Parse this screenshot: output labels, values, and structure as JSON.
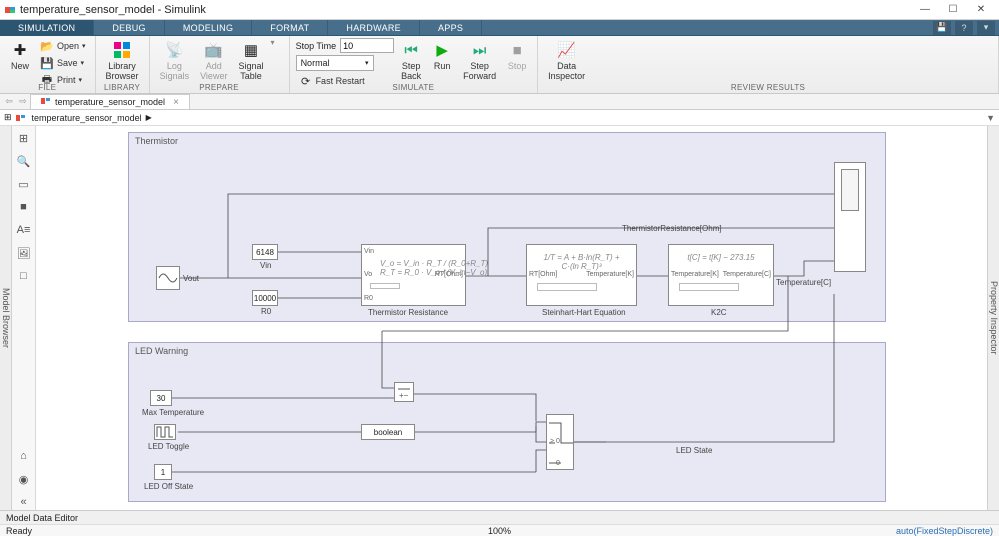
{
  "window": {
    "title": "temperature_sensor_model - Simulink"
  },
  "tabs": [
    "SIMULATION",
    "DEBUG",
    "MODELING",
    "FORMAT",
    "HARDWARE",
    "APPS"
  ],
  "ribbon": {
    "file_group": {
      "new": "New",
      "open": "Open",
      "save": "Save",
      "print": "Print",
      "label": "FILE"
    },
    "library_group": {
      "browser": "Library\nBrowser",
      "label": "LIBRARY"
    },
    "prepare_group": {
      "log": "Log\nSignals",
      "viewer": "Add\nViewer",
      "table": "Signal\nTable",
      "label": "PREPARE"
    },
    "sim_group": {
      "stoptime": "Stop Time",
      "stoptime_val": "10",
      "mode": "Normal",
      "fastrestart": "Fast Restart",
      "stepback": "Step\nBack",
      "run": "Run",
      "stepfwd": "Step\nForward",
      "stop": "Stop",
      "label": "SIMULATE"
    },
    "review_group": {
      "inspector": "Data\nInspector",
      "label": "REVIEW RESULTS"
    }
  },
  "file_tab": "temperature_sensor_model",
  "crumb": "temperature_sensor_model",
  "left_sidebar": "Model Browser",
  "right_sidebar": "Property Inspector",
  "canvas": {
    "area1": {
      "label": "Thermistor"
    },
    "area2": {
      "label": "LED Warning"
    },
    "vin": {
      "label": "Vin",
      "value": "6148"
    },
    "r0": {
      "label": "R0",
      "value": "10000"
    },
    "vout": {
      "label": "Vout"
    },
    "thermres": {
      "label": "Thermistor Resistance",
      "p_vin": "Vin",
      "p_vo": "Vo",
      "p_r0": "R0",
      "p_rt": "RT[Ohm]",
      "formula": "V_o = V_in · R_T / (R_0+R_T)\nR_T = R_0 · V_o / (V_in−V_o)"
    },
    "steinhart": {
      "label": "Steinhart-Hart Equation",
      "p_rt": "RT[Ohm]",
      "p_tk": "Temperature[K]",
      "formula": "1/T = A + B·ln(R_T) + C·(ln R_T)³"
    },
    "k2c": {
      "label": "K2C",
      "p_tk": "Temperature[K]",
      "p_tc": "Temperature[C]",
      "formula": "t[C] = t[K] − 273.15"
    },
    "thermres_sig": "ThermistorResistance[Ohm]",
    "maxtemp": {
      "label": "Max Temperature",
      "value": "30"
    },
    "ledtog": {
      "label": "LED Toggle"
    },
    "ledoff": {
      "label": "LED Off State",
      "value": "1"
    },
    "boolean": "boolean",
    "switch": {
      "cond": "> 0",
      "off": "0"
    },
    "ledstate": "LED State"
  },
  "mde": "Model Data Editor",
  "status": {
    "ready": "Ready",
    "zoom": "100%",
    "mode": "auto(FixedStepDiscrete)"
  }
}
